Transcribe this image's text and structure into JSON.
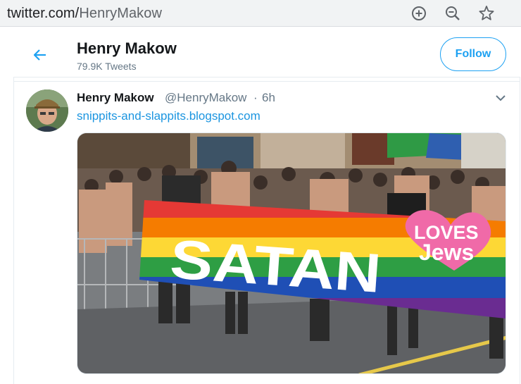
{
  "browser": {
    "url_host": "twitter.com/",
    "url_path": "HenryMakow",
    "icons": [
      "add-circle-icon",
      "zoom-out-icon",
      "star-icon"
    ]
  },
  "profile_header": {
    "name": "Henry Makow",
    "tweet_count": "79.9K Tweets",
    "follow_label": "Follow"
  },
  "tweet": {
    "author_name": "Henry Makow",
    "author_handle": "@HenryMakow",
    "separator": "·",
    "time": "6h",
    "link_text": "snippits-and-slappits.blogspot.com",
    "image": {
      "banner_main": "SATAN",
      "heart_line1": "LOVES",
      "heart_line2": "Jews"
    }
  },
  "colors": {
    "accent": "#1da1f2",
    "link": "#1b95e0",
    "muted": "#657786"
  }
}
